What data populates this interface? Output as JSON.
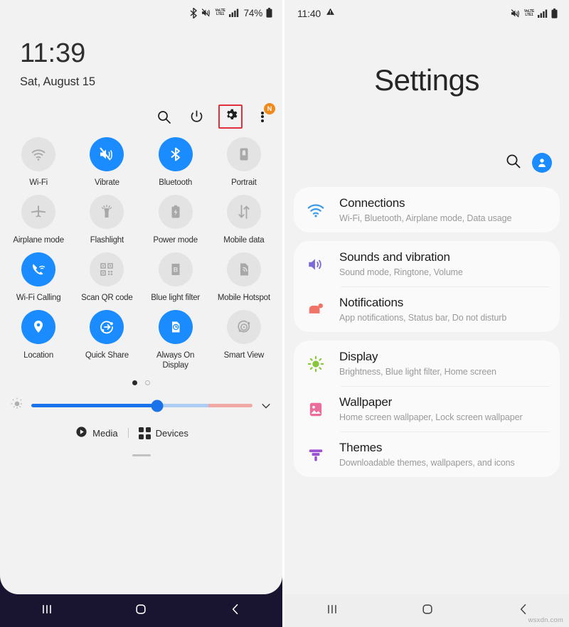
{
  "left_panel": {
    "status_bar": {
      "icons": [
        "bluetooth-icon",
        "vibrate-icon",
        "volte-icon",
        "signal-icon",
        "battery-icon"
      ],
      "volte_top": "VoLTE",
      "volte_bottom": "LTE1",
      "battery_percent": "74%"
    },
    "clock": {
      "time": "11:39",
      "date": "Sat, August 15"
    },
    "header_actions": {
      "search_label": "Search",
      "power_label": "Power off",
      "settings_label": "Settings",
      "more_label": "More options",
      "badge": "N"
    },
    "tiles": [
      {
        "label": "Wi-Fi",
        "icon": "wifi-icon",
        "active": false
      },
      {
        "label": "Vibrate",
        "icon": "vibrate-icon",
        "active": true
      },
      {
        "label": "Bluetooth",
        "icon": "bluetooth-icon",
        "active": true
      },
      {
        "label": "Portrait",
        "icon": "portrait-rotation-icon",
        "active": false
      },
      {
        "label": "Airplane mode",
        "icon": "airplane-icon",
        "active": false
      },
      {
        "label": "Flashlight",
        "icon": "flashlight-icon",
        "active": false
      },
      {
        "label": "Power mode",
        "icon": "power-mode-icon",
        "active": false
      },
      {
        "label": "Mobile data",
        "icon": "mobile-data-icon",
        "active": false
      },
      {
        "label": "Wi-Fi Calling",
        "icon": "wifi-calling-icon",
        "active": true
      },
      {
        "label": "Scan QR code",
        "icon": "qr-code-icon",
        "active": false
      },
      {
        "label": "Blue light filter",
        "icon": "blue-light-filter-icon",
        "active": false
      },
      {
        "label": "Mobile Hotspot",
        "icon": "mobile-hotspot-icon",
        "active": false
      },
      {
        "label": "Location",
        "icon": "location-pin-icon",
        "active": true
      },
      {
        "label": "Quick Share",
        "icon": "quick-share-icon",
        "active": true
      },
      {
        "label": "Always On Display",
        "icon": "always-on-display-icon",
        "active": true
      },
      {
        "label": "Smart View",
        "icon": "smart-view-icon",
        "active": false
      }
    ],
    "pagination": {
      "total": 2,
      "current": 1
    },
    "brightness": {
      "value_percent": 57,
      "auto_icon": "brightness-icon",
      "expand_icon": "chevron-down-icon"
    },
    "footer": {
      "media_label": "Media",
      "devices_label": "Devices"
    },
    "navbar": {
      "recents": "recents-button",
      "home": "home-button",
      "back": "back-button"
    }
  },
  "right_panel": {
    "status_bar": {
      "time": "11:40",
      "warning_icon": "warning-triangle-icon",
      "icons": [
        "vibrate-icon",
        "volte-icon",
        "signal-icon",
        "battery-icon"
      ],
      "volte_top": "VoLTE",
      "volte_bottom": "LTE1"
    },
    "title": "Settings",
    "actions": {
      "search_label": "Search",
      "account_label": "Samsung account"
    },
    "cards": [
      {
        "rows": [
          {
            "title": "Connections",
            "subtitle": "Wi-Fi, Bluetooth, Airplane mode, Data usage",
            "icon": "wifi-icon",
            "color": "#3d9ae8"
          }
        ]
      },
      {
        "rows": [
          {
            "title": "Sounds and vibration",
            "subtitle": "Sound mode, Ringtone, Volume",
            "icon": "speaker-icon",
            "color": "#7a6ad6"
          },
          {
            "title": "Notifications",
            "subtitle": "App notifications, Status bar, Do not disturb",
            "icon": "notification-icon",
            "color": "#f07368"
          }
        ]
      },
      {
        "rows": [
          {
            "title": "Display",
            "subtitle": "Brightness, Blue light filter, Home screen",
            "icon": "brightness-icon",
            "color": "#8ac53e"
          },
          {
            "title": "Wallpaper",
            "subtitle": "Home screen wallpaper, Lock screen wallpaper",
            "icon": "wallpaper-icon",
            "color": "#ec6d9c"
          },
          {
            "title": "Themes",
            "subtitle": "Downloadable themes, wallpapers, and icons",
            "icon": "themes-brush-icon",
            "color": "#9b4fd1"
          }
        ]
      }
    ],
    "navbar": {
      "recents": "recents-button",
      "home": "home-button",
      "back": "back-button"
    },
    "watermark": "wsxdn.com"
  }
}
